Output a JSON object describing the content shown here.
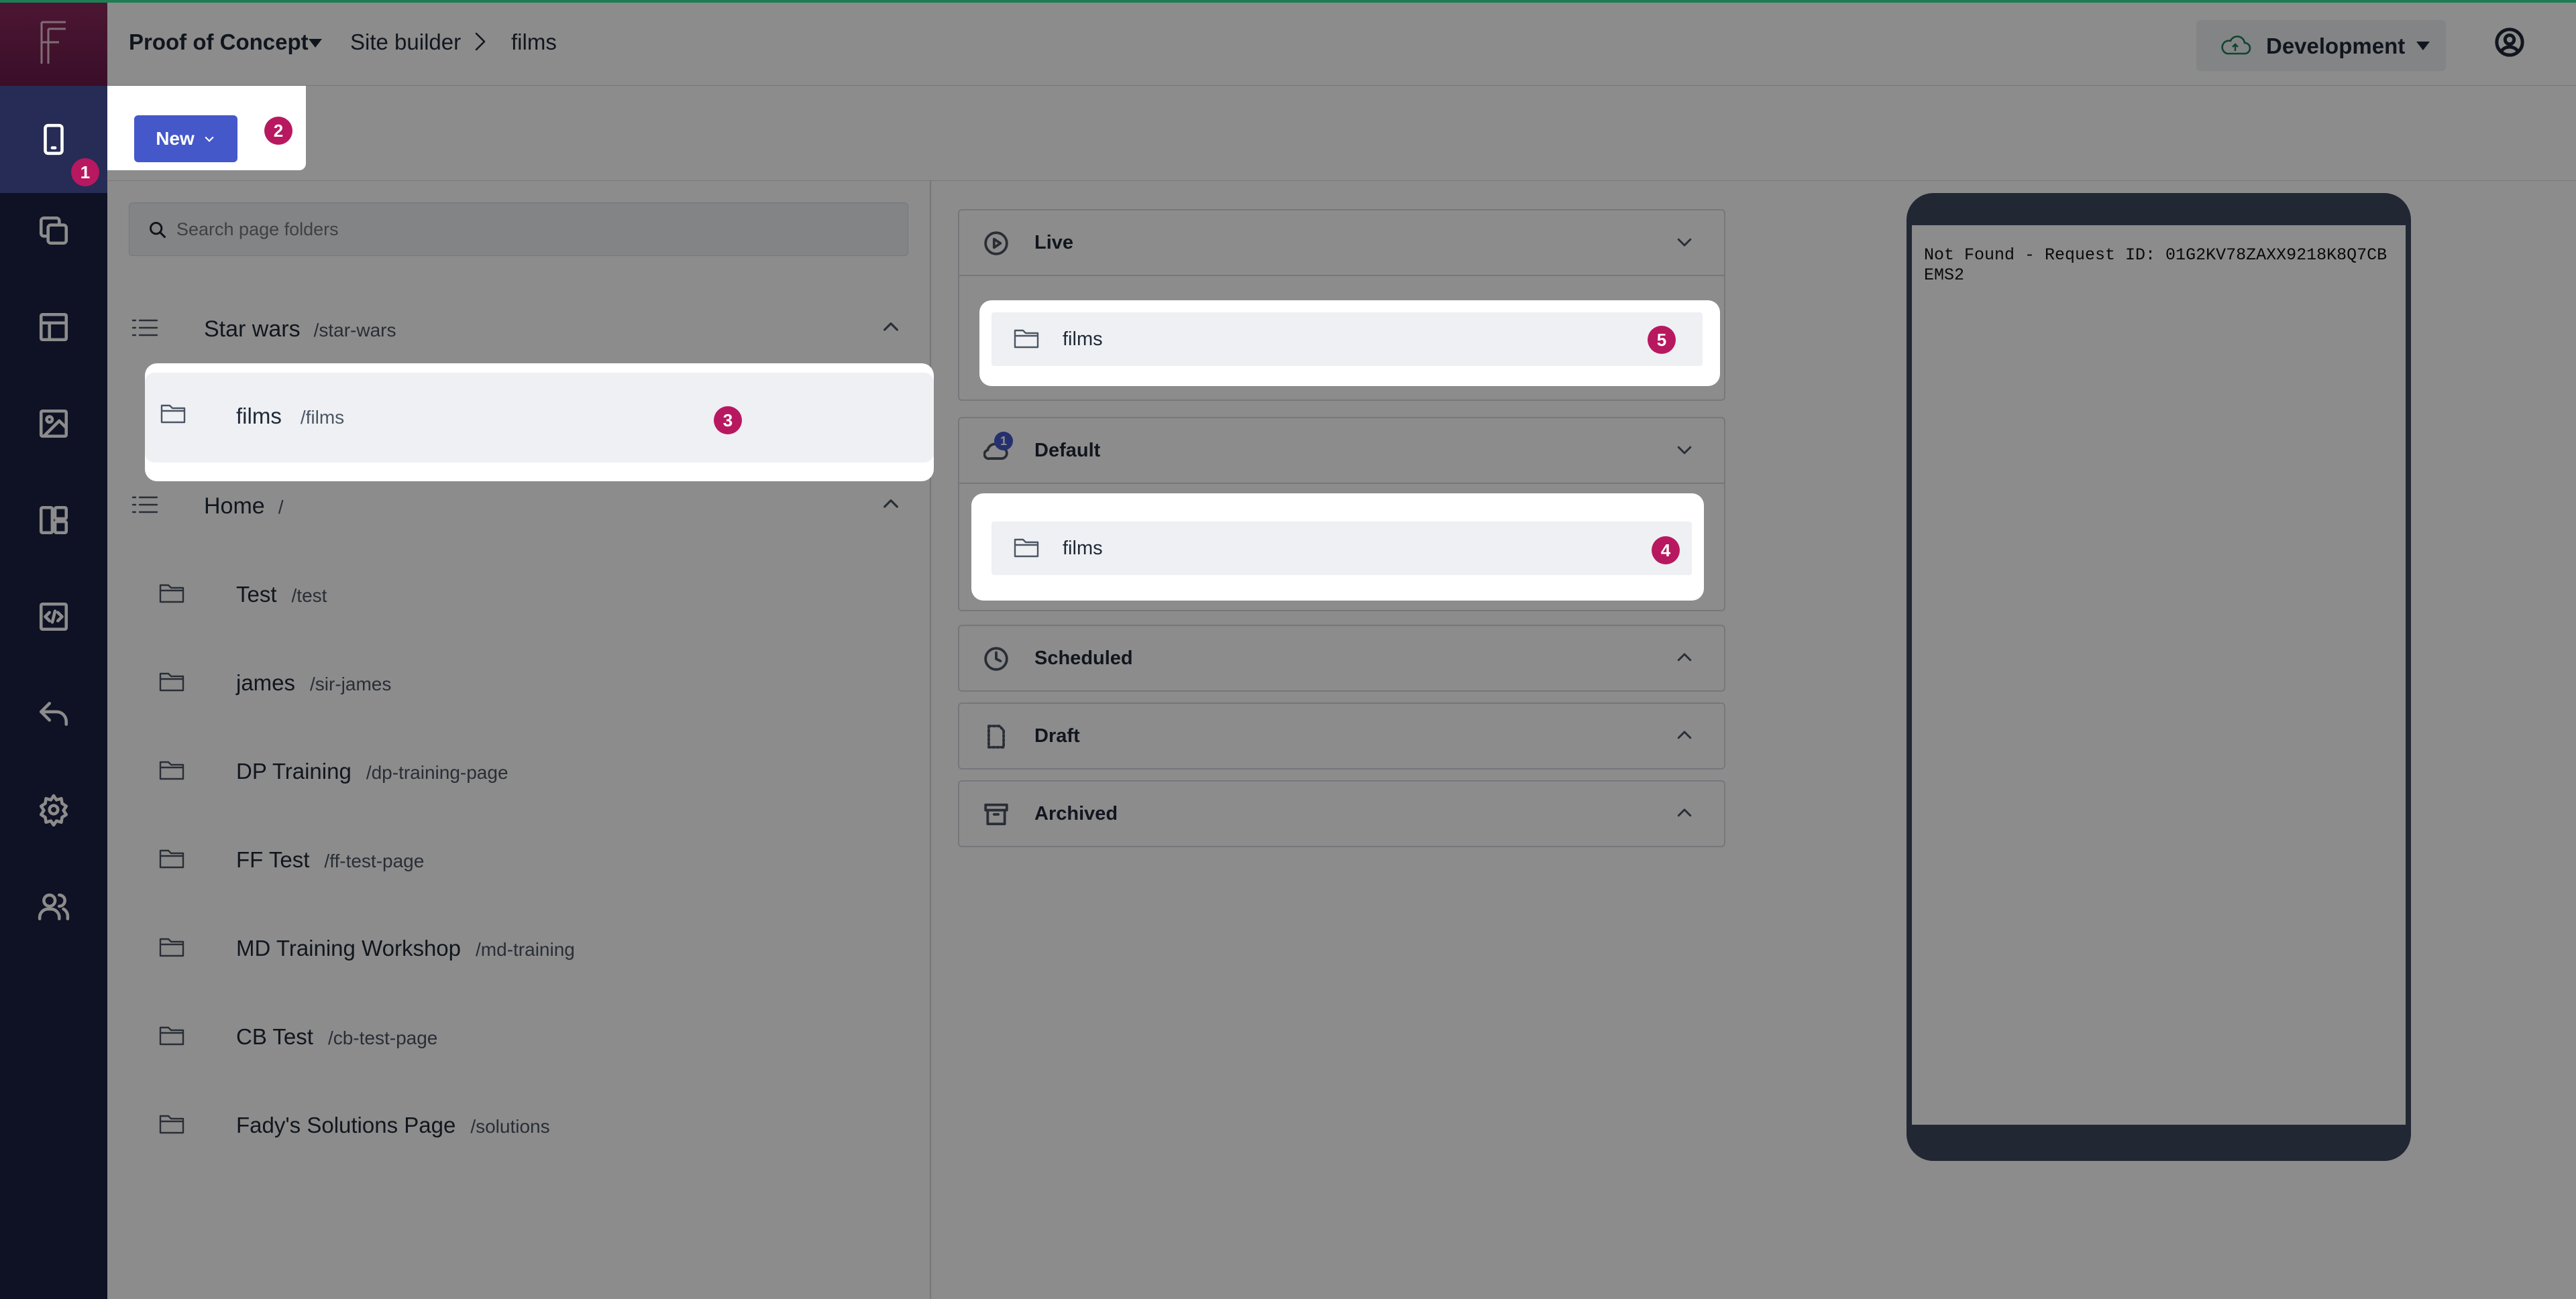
{
  "header": {
    "project": "Proof of Concept",
    "site_builder": "Site builder",
    "separator": ">",
    "current": "films",
    "environment": "Development"
  },
  "toolbar": {
    "new_label": "New"
  },
  "search": {
    "placeholder": "Search page folders"
  },
  "tree": {
    "sections": [
      {
        "title": "Star wars",
        "path": "/star-wars",
        "items": [
          {
            "name": "films",
            "path": "/films"
          }
        ]
      },
      {
        "title": "Home",
        "path": "/",
        "items": [
          {
            "name": "Test",
            "path": "/test"
          },
          {
            "name": "james",
            "path": "/sir-james"
          },
          {
            "name": "DP Training",
            "path": "/dp-training-page"
          },
          {
            "name": "FF Test",
            "path": "/ff-test-page"
          },
          {
            "name": "MD Training Workshop",
            "path": "/md-training"
          },
          {
            "name": "CB Test",
            "path": "/cb-test-page"
          },
          {
            "name": "Fady's Solutions Page",
            "path": "/solutions"
          }
        ]
      }
    ]
  },
  "status": {
    "live": {
      "title": "Live",
      "item": "films"
    },
    "default": {
      "title": "Default",
      "badge": "1",
      "item": "films"
    },
    "scheduled": {
      "title": "Scheduled"
    },
    "draft": {
      "title": "Draft"
    },
    "archived": {
      "title": "Archived"
    }
  },
  "preview": {
    "text": "Not Found - Request ID: 01G2KV78ZAXX9218K8Q7CBEMS2"
  },
  "tour_badges": [
    "1",
    "2",
    "3",
    "4",
    "5"
  ],
  "colors": {
    "sidebar": "#1c2143",
    "brand": "#8c2a5d",
    "primary": "#4458c9",
    "badge": "#b8185f",
    "env_icon": "#1e7d52"
  }
}
